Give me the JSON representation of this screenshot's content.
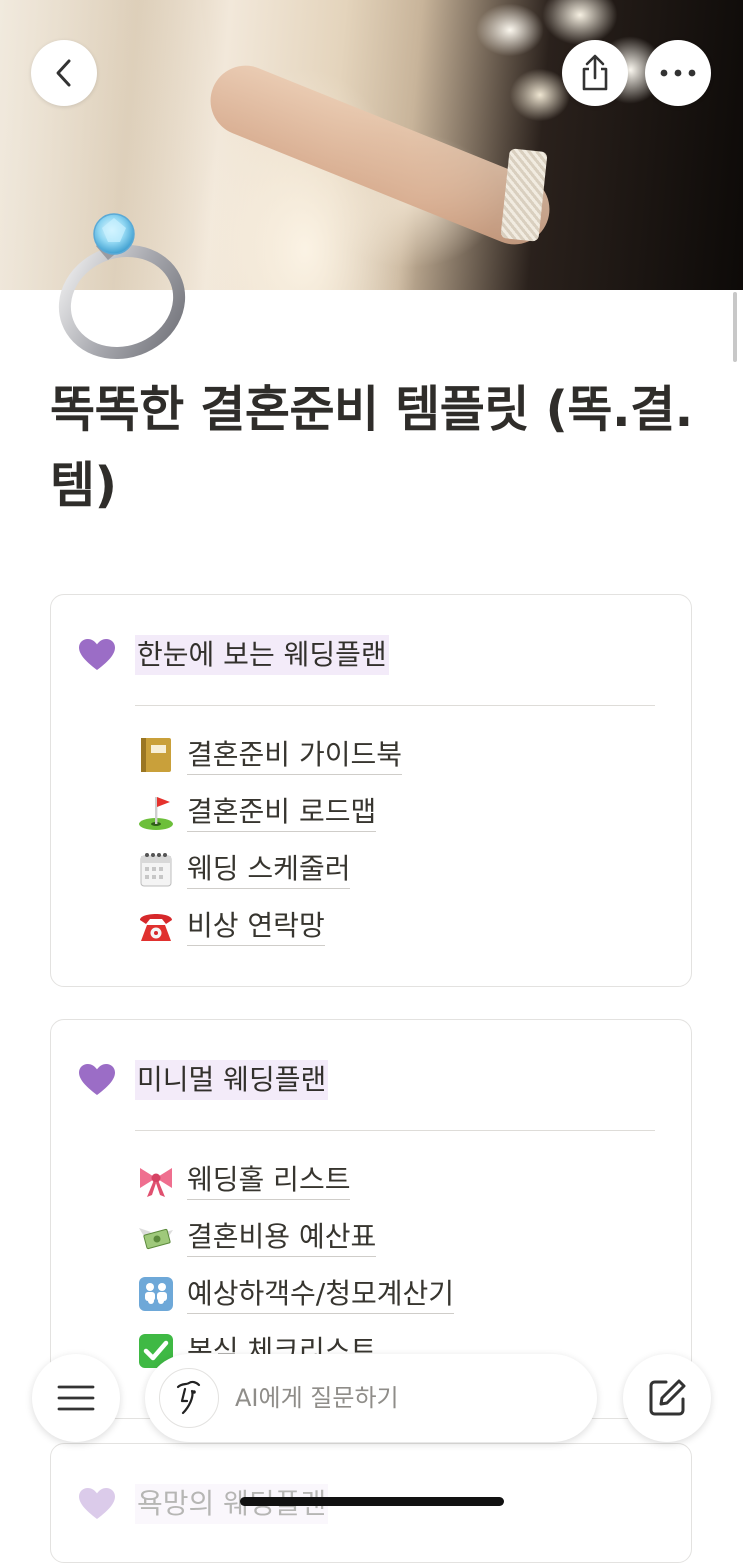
{
  "page": {
    "title": "똑똑한 결혼준비 템플릿 (똑.결.템)",
    "icon": "ring-icon"
  },
  "cover": {
    "buttons": {
      "back": "chevron-left-icon",
      "share": "share-icon",
      "more": "more-horizontal-icon"
    }
  },
  "sections": [
    {
      "heading": "한눈에 보는 웨딩플랜",
      "icon": "purple-heart-icon",
      "links": [
        {
          "emoji": "ledger-icon",
          "label": "결혼준비 가이드북"
        },
        {
          "emoji": "flag-in-hole-icon",
          "label": "결혼준비 로드맵"
        },
        {
          "emoji": "spiral-calendar-icon",
          "label": "웨딩 스케줄러"
        },
        {
          "emoji": "telephone-icon",
          "label": "비상 연락망"
        }
      ]
    },
    {
      "heading": "미니멀 웨딩플랜",
      "icon": "purple-heart-icon",
      "links": [
        {
          "emoji": "ribbon-icon",
          "label": "웨딩홀 리스트"
        },
        {
          "emoji": "money-with-wings-icon",
          "label": "결혼비용 예산표"
        },
        {
          "emoji": "family-icon",
          "label": "예상하객수/청모계산기"
        },
        {
          "emoji": "check-mark-button-icon",
          "label": "본식 체크리스트"
        }
      ]
    },
    {
      "heading": "욕망의 웨딩플랜",
      "icon": "purple-heart-icon",
      "links": []
    }
  ],
  "bottom_bar": {
    "menu_icon": "hamburger-icon",
    "ai_placeholder": "AI에게 질문하기",
    "ai_icon": "notion-ai-face-icon",
    "compose_icon": "compose-icon"
  },
  "colors": {
    "heading_highlight": "#f3ebf9",
    "heart": "#9b6dc6",
    "text": "#37352f",
    "placeholder": "#8f8d89"
  }
}
